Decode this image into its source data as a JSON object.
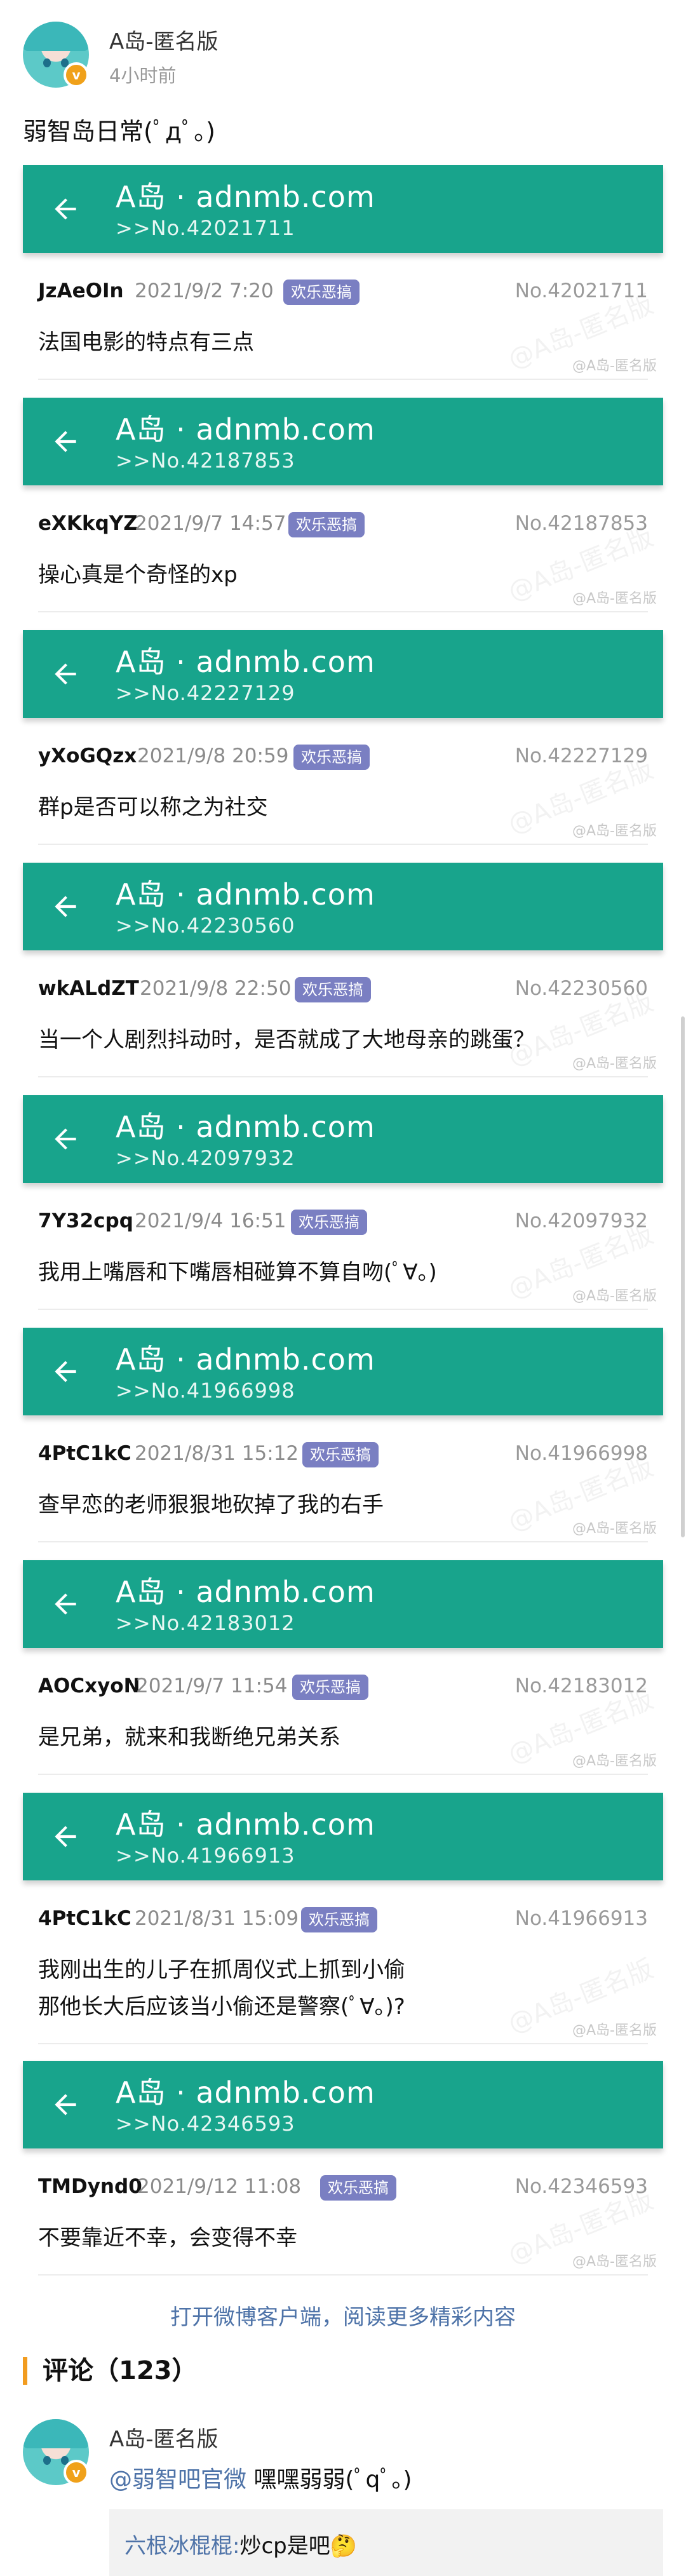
{
  "post": {
    "author": "A岛-匿名版",
    "time": "4小时前",
    "text": "弱智岛日常(ﾟдﾟ。)",
    "verified_badge": "v"
  },
  "cards": [
    {
      "title": "A岛 · adnmb.com",
      "sub": ">>No.42021711",
      "uid": "JzAeOIn",
      "date": "2021/9/2 7:20",
      "tag": "欢乐恶搞",
      "no": "No.42021711",
      "text": "法国电影的特点有三点"
    },
    {
      "title": "A岛 · adnmb.com",
      "sub": ">>No.42187853",
      "uid": "eXKkqYZ",
      "date": "2021/9/7 14:57",
      "tag": "欢乐恶搞",
      "no": "No.42187853",
      "text": "操心真是个奇怪的xp"
    },
    {
      "title": "A岛 · adnmb.com",
      "sub": ">>No.42227129",
      "uid": "yXoGQzx",
      "date": "2021/9/8 20:59",
      "tag": "欢乐恶搞",
      "no": "No.42227129",
      "text": "群p是否可以称之为社交"
    },
    {
      "title": "A岛 · adnmb.com",
      "sub": ">>No.42230560",
      "uid": "wkALdZT",
      "date": "2021/9/8 22:50",
      "tag": "欢乐恶搞",
      "no": "No.42230560",
      "text": "当一个人剧烈抖动时，是否就成了大地母亲的跳蛋？"
    },
    {
      "title": "A岛 · adnmb.com",
      "sub": ">>No.42097932",
      "uid": "7Y32cpq",
      "date": "2021/9/4 16:51",
      "tag": "欢乐恶搞",
      "no": "No.42097932",
      "text": "我用上嘴唇和下嘴唇相碰算不算自吻(ﾟ∀。)"
    },
    {
      "title": "A岛 · adnmb.com",
      "sub": ">>No.41966998",
      "uid": "4PtC1kC",
      "date": "2021/8/31 15:12",
      "tag": "欢乐恶搞",
      "no": "No.41966998",
      "text": "查早恋的老师狠狠地砍掉了我的右手"
    },
    {
      "title": "A岛 · adnmb.com",
      "sub": ">>No.42183012",
      "uid": "AOCxyoN",
      "date": "2021/9/7 11:54",
      "tag": "欢乐恶搞",
      "no": "No.42183012",
      "text": "是兄弟，就来和我断绝兄弟关系"
    },
    {
      "title": "A岛 · adnmb.com",
      "sub": ">>No.41966913",
      "uid": "4PtC1kC",
      "date": "2021/8/31 15:09",
      "tag": "欢乐恶搞",
      "no": "No.41966913",
      "text": "我刚出生的儿子在抓周仪式上抓到小偷\n那他长大后应该当小偷还是警察(ﾟ∀。)?"
    },
    {
      "title": "A岛 · adnmb.com",
      "sub": ">>No.42346593",
      "uid": "TMDynd0",
      "date": "2021/9/12 11:08",
      "tag": "欢乐恶搞",
      "no": "No.42346593",
      "text": "不要靠近不幸，会变得不幸"
    }
  ],
  "watermark": {
    "big": "@A岛-匿名版",
    "small": "@A岛-匿名版"
  },
  "footer": {
    "open_weibo": "打开微博客户端，阅读更多精彩内容",
    "comments_title": "评论（123）"
  },
  "comment": {
    "author": "A岛-匿名版",
    "mention": "@弱智吧官微",
    "text": " 嘿嘿弱弱(ﾟqﾟ。)",
    "reply_who": "六根冰棍棍:",
    "reply_text": "炒cp是吧🤔"
  },
  "colors": {
    "card_bar": "#18a48c",
    "tag": "#7a7fc2",
    "link": "#4e73a8",
    "accent": "#f29c1f"
  }
}
